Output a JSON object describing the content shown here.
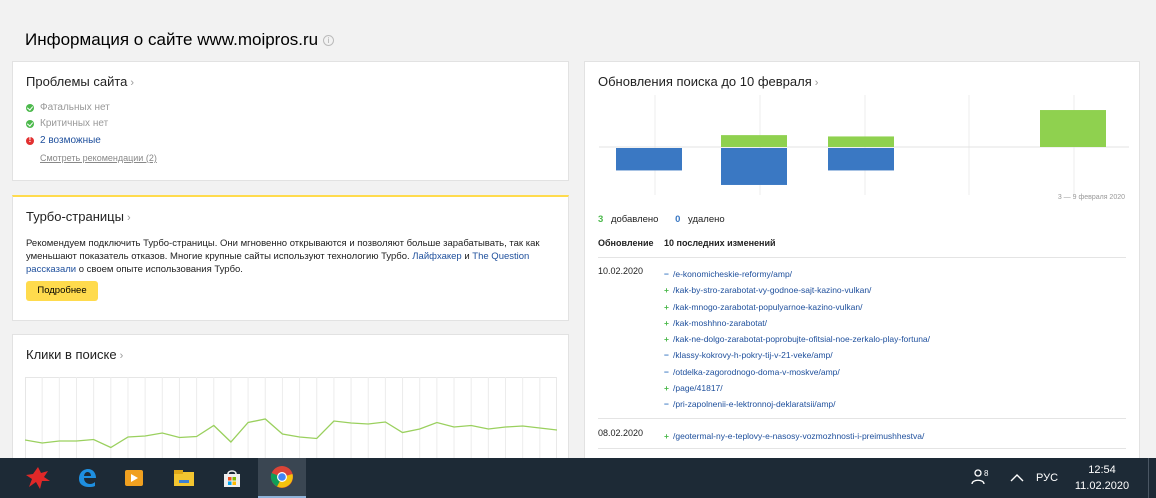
{
  "header": {
    "title": "Информация о сайте www.moipros.ru"
  },
  "problems": {
    "title": "Проблемы сайта",
    "items": [
      {
        "status": "ok",
        "text": "Фатальных нет"
      },
      {
        "status": "ok",
        "text": "Критичных нет"
      },
      {
        "status": "error",
        "text": "2 возможные"
      }
    ],
    "recommendations_link": "Смотреть рекомендации (2)"
  },
  "turbo": {
    "title": "Турбо-страницы",
    "text_1": "Рекомендуем подключить Турбо-страницы. Они мгновенно открываются и позволяют больше зарабатывать, так как уменьшают показатель отказов. Многие крупные сайты используют технологию Турбо.",
    "link_1": "Лайфхакер",
    "text_and": "и",
    "link_2": "The Question рассказали",
    "text_2": "о своем опыте использования Турбо.",
    "button_label": "Подробнее"
  },
  "clicks": {
    "title": "Клики в поиске",
    "series": [
      0.42,
      0.36,
      0.4,
      0.4,
      0.43,
      0.27,
      0.48,
      0.5,
      0.56,
      0.47,
      0.49,
      0.71,
      0.38,
      0.77,
      0.84,
      0.54,
      0.48,
      0.45,
      0.8,
      0.76,
      0.74,
      0.78,
      0.57,
      0.64,
      0.77,
      0.68,
      0.71,
      0.64,
      0.68,
      0.7,
      0.66,
      0.62
    ]
  },
  "search_updates": {
    "title": "Обновления поиска до 10 февраля",
    "date_range": "3 — 9 февраля 2020",
    "added_count": "3",
    "added_label": "добавлено",
    "removed_count": "0",
    "removed_label": "удалено",
    "col_update": "Обновление",
    "col_changes": "10 последних изменений",
    "bars": [
      {
        "added": 0,
        "removed": 0.34
      },
      {
        "added": 0.18,
        "removed": 0.56
      },
      {
        "added": 0.16,
        "removed": 0.34
      },
      {
        "added": 0.56,
        "removed": 0
      }
    ],
    "groups": [
      {
        "date": "10.02.2020",
        "changes": [
          {
            "sign": "−",
            "type": "removed",
            "url": "/e-konomicheskie-reformy/amp/"
          },
          {
            "sign": "+",
            "type": "added",
            "url": "/kak-by-stro-zarabotat-vy-godnoe-sajt-kazino-vulkan/"
          },
          {
            "sign": "+",
            "type": "added",
            "url": "/kak-mnogo-zarabotat-populyarnoe-kazino-vulkan/"
          },
          {
            "sign": "+",
            "type": "added",
            "url": "/kak-moshhno-zarabotat/"
          },
          {
            "sign": "+",
            "type": "added",
            "url": "/kak-ne-dolgo-zarabotat-poprobujte-ofitsial-noe-zerkalo-play-fortuna/"
          },
          {
            "sign": "−",
            "type": "removed",
            "url": "/klassy-kokrovy-h-pokry-tij-v-21-veke/amp/"
          },
          {
            "sign": "−",
            "type": "removed",
            "url": "/otdelka-zagorodnogo-doma-v-moskve/amp/"
          },
          {
            "sign": "+",
            "type": "added",
            "url": "/page/41817/"
          },
          {
            "sign": "−",
            "type": "removed",
            "url": "/pri-zapolnenii-e-lektronnoj-deklaratsii/amp/"
          }
        ]
      },
      {
        "date": "08.02.2020",
        "changes": [
          {
            "sign": "+",
            "type": "added",
            "url": "/geotermal-ny-e-teplovy-e-nasosy-vozmozhnosti-i-preimushhestva/"
          }
        ]
      }
    ]
  },
  "taskbar": {
    "lang": "РУС",
    "time": "12:54",
    "date": "11.02.2020",
    "apps": [
      "antivirus-icon",
      "edge-icon",
      "media-player-icon",
      "file-explorer-icon",
      "store-icon",
      "chrome-icon"
    ]
  },
  "colors": {
    "added": "#8fd14f",
    "removed": "#3a78c3",
    "line": "#9ad05e",
    "accent": "#ffdb4d",
    "link": "#1e4f9c"
  }
}
